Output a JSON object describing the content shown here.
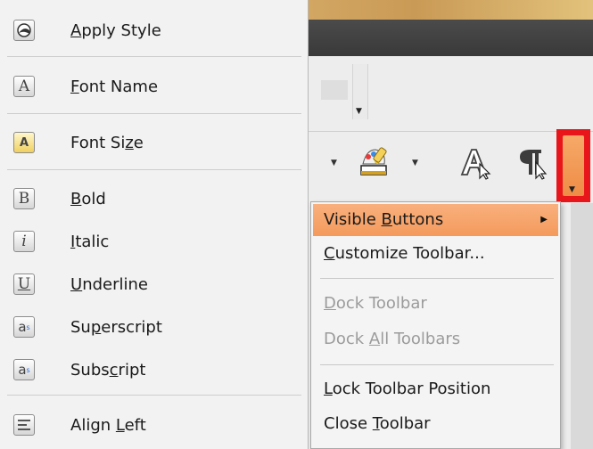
{
  "colors": {
    "highlight": "#f49a5c",
    "overflow_button": "#ef8c47",
    "focus_outline": "#e8161b",
    "disabled_text": "#9b9b9b"
  },
  "left_menu": {
    "items": [
      {
        "icon": "apply-style-icon",
        "pre": "",
        "u": "A",
        "post": "pply Style"
      },
      {
        "icon": "font-name-icon",
        "pre": "",
        "u": "F",
        "post": "ont Name"
      },
      {
        "icon": "font-size-icon",
        "pre": "Font Si",
        "u": "z",
        "post": "e"
      },
      {
        "icon": "bold-icon",
        "pre": "",
        "u": "B",
        "post": "old"
      },
      {
        "icon": "italic-icon",
        "pre": "",
        "u": "I",
        "post": "talic"
      },
      {
        "icon": "underline-icon",
        "pre": "",
        "u": "U",
        "post": "nderline"
      },
      {
        "icon": "superscript-icon",
        "pre": "Su",
        "u": "p",
        "post": "erscript"
      },
      {
        "icon": "subscript-icon",
        "pre": "Subs",
        "u": "c",
        "post": "ript"
      },
      {
        "icon": "align-left-icon",
        "pre": "Align ",
        "u": "L",
        "post": "eft"
      }
    ]
  },
  "context_menu": {
    "visible_buttons": {
      "pre": "Visible ",
      "u": "B",
      "post": "uttons"
    },
    "customize_toolbar": {
      "pre": "",
      "u": "C",
      "post": "ustomize Toolbar..."
    },
    "dock_toolbar": {
      "pre": "",
      "u": "D",
      "post": "ock Toolbar"
    },
    "dock_all_toolbars": {
      "pre": "Dock ",
      "u": "A",
      "post": "ll Toolbars"
    },
    "lock_toolbar_position": {
      "pre": "",
      "u": "L",
      "post": "ock Toolbar Position"
    },
    "close_toolbar": {
      "pre": "Close ",
      "u": "T",
      "post": "oolbar"
    }
  }
}
